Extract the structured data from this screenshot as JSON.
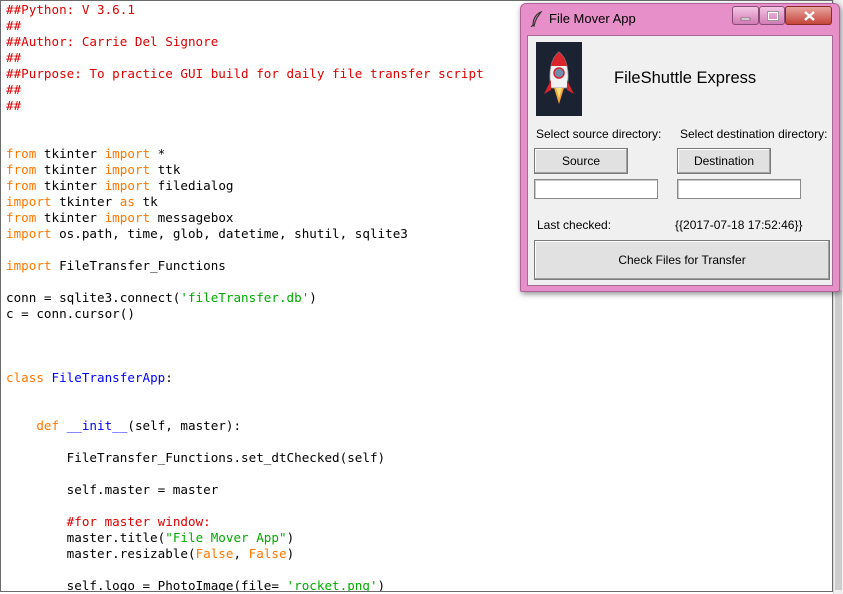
{
  "editor": {
    "lines": [
      [
        {
          "t": "##Python: V 3.6.1",
          "c": "comment"
        }
      ],
      [
        {
          "t": "##",
          "c": "comment"
        }
      ],
      [
        {
          "t": "##Author: Carrie Del Signore",
          "c": "comment"
        }
      ],
      [
        {
          "t": "##",
          "c": "comment"
        }
      ],
      [
        {
          "t": "##Purpose: To practice GUI build for daily file transfer script",
          "c": "comment"
        }
      ],
      [
        {
          "t": "##",
          "c": "comment"
        }
      ],
      [
        {
          "t": "##",
          "c": "comment"
        }
      ],
      [],
      [],
      [
        {
          "t": "from",
          "c": "kw"
        },
        {
          "t": " tkinter ",
          "c": "plain"
        },
        {
          "t": "import",
          "c": "kw"
        },
        {
          "t": " *",
          "c": "plain"
        }
      ],
      [
        {
          "t": "from",
          "c": "kw"
        },
        {
          "t": " tkinter ",
          "c": "plain"
        },
        {
          "t": "import",
          "c": "kw"
        },
        {
          "t": " ttk",
          "c": "plain"
        }
      ],
      [
        {
          "t": "from",
          "c": "kw"
        },
        {
          "t": " tkinter ",
          "c": "plain"
        },
        {
          "t": "import",
          "c": "kw"
        },
        {
          "t": " filedialog",
          "c": "plain"
        }
      ],
      [
        {
          "t": "import",
          "c": "kw"
        },
        {
          "t": " tkinter ",
          "c": "plain"
        },
        {
          "t": "as",
          "c": "kw"
        },
        {
          "t": " tk",
          "c": "plain"
        }
      ],
      [
        {
          "t": "from",
          "c": "kw"
        },
        {
          "t": " tkinter ",
          "c": "plain"
        },
        {
          "t": "import",
          "c": "kw"
        },
        {
          "t": " messagebox",
          "c": "plain"
        }
      ],
      [
        {
          "t": "import",
          "c": "kw"
        },
        {
          "t": " os.path, time, glob, datetime, shutil, sqlite3",
          "c": "plain"
        }
      ],
      [],
      [
        {
          "t": "import",
          "c": "kw"
        },
        {
          "t": " FileTransfer_Functions",
          "c": "plain"
        }
      ],
      [],
      [
        {
          "t": "conn = sqlite3.connect(",
          "c": "plain"
        },
        {
          "t": "'fileTransfer.db'",
          "c": "str"
        },
        {
          "t": ")",
          "c": "plain"
        }
      ],
      [
        {
          "t": "c = conn.cursor()",
          "c": "plain"
        }
      ],
      [],
      [],
      [],
      [
        {
          "t": "class",
          "c": "kw"
        },
        {
          "t": " ",
          "c": "plain"
        },
        {
          "t": "FileTransferApp",
          "c": "def"
        },
        {
          "t": ":",
          "c": "plain"
        }
      ],
      [],
      [],
      [
        {
          "t": "    ",
          "c": "plain"
        },
        {
          "t": "def",
          "c": "kw"
        },
        {
          "t": " ",
          "c": "plain"
        },
        {
          "t": "__init__",
          "c": "def"
        },
        {
          "t": "(self, master):",
          "c": "plain"
        }
      ],
      [],
      [
        {
          "t": "        FileTransfer_Functions.set_dtChecked(self)",
          "c": "plain"
        }
      ],
      [],
      [
        {
          "t": "        self.master = master",
          "c": "plain"
        }
      ],
      [],
      [
        {
          "t": "        ",
          "c": "plain"
        },
        {
          "t": "#for master window:",
          "c": "comment"
        }
      ],
      [
        {
          "t": "        master.title(",
          "c": "plain"
        },
        {
          "t": "\"File Mover App\"",
          "c": "str"
        },
        {
          "t": ")",
          "c": "plain"
        }
      ],
      [
        {
          "t": "        master.resizable(",
          "c": "plain"
        },
        {
          "t": "False",
          "c": "kw"
        },
        {
          "t": ", ",
          "c": "plain"
        },
        {
          "t": "False",
          "c": "kw"
        },
        {
          "t": ")",
          "c": "plain"
        }
      ],
      [],
      [
        {
          "t": "        self.logo = PhotoImage(file= ",
          "c": "plain"
        },
        {
          "t": "'rocket.png'",
          "c": "str"
        },
        {
          "t": ")",
          "c": "plain"
        }
      ]
    ]
  },
  "app": {
    "window_title": "File Mover App",
    "heading": "FileShuttle Express",
    "source_label": "Select source directory:",
    "destination_label": "Select destination directory:",
    "source_button": "Source",
    "destination_button": "Destination",
    "source_value": "",
    "destination_value": "",
    "last_checked_label": "Last checked:",
    "last_checked_value": "{{2017-07-18 17:52:46}}",
    "check_button": "Check Files for Transfer",
    "icons": {
      "title": "feather-icon",
      "logo": "rocket-logo",
      "minimize": "minimize-icon",
      "maximize": "maximize-icon",
      "close": "close-icon"
    },
    "colors": {
      "frame": "#e68fc8",
      "client": "#f0f0f0",
      "button": "#e1e1e1"
    }
  },
  "syntax_colors": {
    "comment": "#dd0000",
    "keyword": "#ff7700",
    "string": "#00aa00",
    "definition": "#0000ff"
  }
}
